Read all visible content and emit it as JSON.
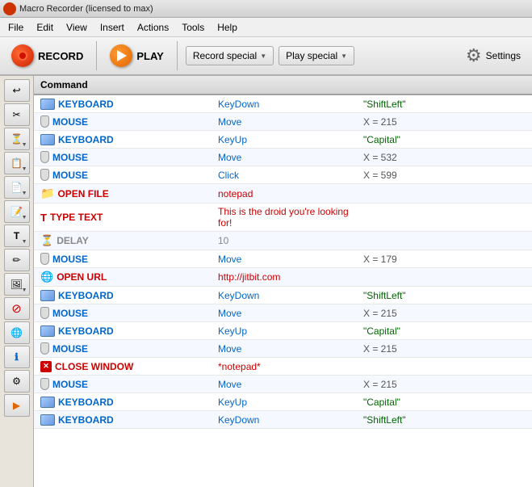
{
  "titleBar": {
    "text": "Macro Recorder (licensed to max)"
  },
  "menuBar": {
    "items": [
      "File",
      "Edit",
      "View",
      "Insert",
      "Actions",
      "Tools",
      "Help"
    ]
  },
  "toolbar": {
    "recordLabel": "RECORD",
    "playLabel": "PLAY",
    "recordSpecialLabel": "Record special",
    "playSpecialLabel": "Play special",
    "settingsLabel": "Settings"
  },
  "table": {
    "header": {
      "command": "Command",
      "action": "",
      "value": ""
    },
    "rows": [
      {
        "icon": "keyboard",
        "cmd": "KEYBOARD",
        "cmdClass": "blue",
        "action": "KeyDown",
        "actClass": "blue",
        "value": "\"ShiftLeft\"",
        "valClass": "green"
      },
      {
        "icon": "mouse",
        "cmd": "MOUSE",
        "cmdClass": "blue",
        "action": "Move",
        "actClass": "blue",
        "value": "X = 215",
        "valClass": "gray"
      },
      {
        "icon": "keyboard",
        "cmd": "KEYBOARD",
        "cmdClass": "blue",
        "action": "KeyUp",
        "actClass": "blue",
        "value": "\"Capital\"",
        "valClass": "green"
      },
      {
        "icon": "mouse",
        "cmd": "MOUSE",
        "cmdClass": "blue",
        "action": "Move",
        "actClass": "blue",
        "value": "X = 532",
        "valClass": "gray"
      },
      {
        "icon": "mouse",
        "cmd": "MOUSE",
        "cmdClass": "blue",
        "action": "Click",
        "actClass": "blue",
        "value": "X = 599",
        "valClass": "gray"
      },
      {
        "icon": "file",
        "cmd": "OPEN FILE",
        "cmdClass": "red",
        "action": "notepad",
        "actClass": "red",
        "value": "",
        "valClass": "gray"
      },
      {
        "icon": "text",
        "cmd": "TYPE TEXT",
        "cmdClass": "red",
        "action": "This is the droid you're looking for!",
        "actClass": "red",
        "value": "",
        "valClass": "gray"
      },
      {
        "icon": "delay",
        "cmd": "DELAY",
        "cmdClass": "gray",
        "action": "10",
        "actClass": "gray",
        "value": "",
        "valClass": "gray"
      },
      {
        "icon": "mouse",
        "cmd": "MOUSE",
        "cmdClass": "blue",
        "action": "Move",
        "actClass": "blue",
        "value": "X = 179",
        "valClass": "gray"
      },
      {
        "icon": "url",
        "cmd": "OPEN URL",
        "cmdClass": "red",
        "action": "http://jitbit.com",
        "actClass": "red",
        "value": "",
        "valClass": "gray"
      },
      {
        "icon": "keyboard",
        "cmd": "KEYBOARD",
        "cmdClass": "blue",
        "action": "KeyDown",
        "actClass": "blue",
        "value": "\"ShiftLeft\"",
        "valClass": "green"
      },
      {
        "icon": "mouse",
        "cmd": "MOUSE",
        "cmdClass": "blue",
        "action": "Move",
        "actClass": "blue",
        "value": "X = 215",
        "valClass": "gray"
      },
      {
        "icon": "keyboard",
        "cmd": "KEYBOARD",
        "cmdClass": "blue",
        "action": "KeyUp",
        "actClass": "blue",
        "value": "\"Capital\"",
        "valClass": "green"
      },
      {
        "icon": "mouse",
        "cmd": "MOUSE",
        "cmdClass": "blue",
        "action": "Move",
        "actClass": "blue",
        "value": "X = 215",
        "valClass": "gray"
      },
      {
        "icon": "close",
        "cmd": "CLOSE WINDOW",
        "cmdClass": "red",
        "action": "*notepad*",
        "actClass": "red",
        "value": "",
        "valClass": "gray"
      },
      {
        "icon": "mouse",
        "cmd": "MOUSE",
        "cmdClass": "blue",
        "action": "Move",
        "actClass": "blue",
        "value": "X = 215",
        "valClass": "gray"
      },
      {
        "icon": "keyboard",
        "cmd": "KEYBOARD",
        "cmdClass": "blue",
        "action": "KeyUp",
        "actClass": "blue",
        "value": "\"Capital\"",
        "valClass": "green"
      },
      {
        "icon": "keyboard",
        "cmd": "KEYBOARD",
        "cmdClass": "blue",
        "action": "KeyDown",
        "actClass": "blue",
        "value": "\"ShiftLeft\"",
        "valClass": "green"
      }
    ]
  },
  "leftToolbar": {
    "buttons": [
      {
        "icon": "↩",
        "name": "undo-btn"
      },
      {
        "icon": "✂",
        "name": "cut-btn"
      },
      {
        "icon": "⏳",
        "name": "delay-btn",
        "hasArrow": true
      },
      {
        "icon": "📋",
        "name": "paste-btn",
        "hasArrow": true
      },
      {
        "icon": "📄",
        "name": "copy-btn",
        "hasArrow": true
      },
      {
        "icon": "📝",
        "name": "edit-btn",
        "hasArrow": true
      },
      {
        "icon": "T",
        "name": "text-btn",
        "hasArrow": true
      },
      {
        "icon": "✏",
        "name": "pencil-btn"
      },
      {
        "icon": "🖼",
        "name": "image-btn",
        "hasArrow": true
      },
      {
        "icon": "⊘",
        "name": "stop-btn"
      },
      {
        "icon": "🌐",
        "name": "url-btn"
      },
      {
        "icon": "ℹ",
        "name": "info-btn"
      },
      {
        "icon": "⚙",
        "name": "settings-btn2"
      },
      {
        "icon": "▶",
        "name": "play-btn2"
      }
    ]
  }
}
